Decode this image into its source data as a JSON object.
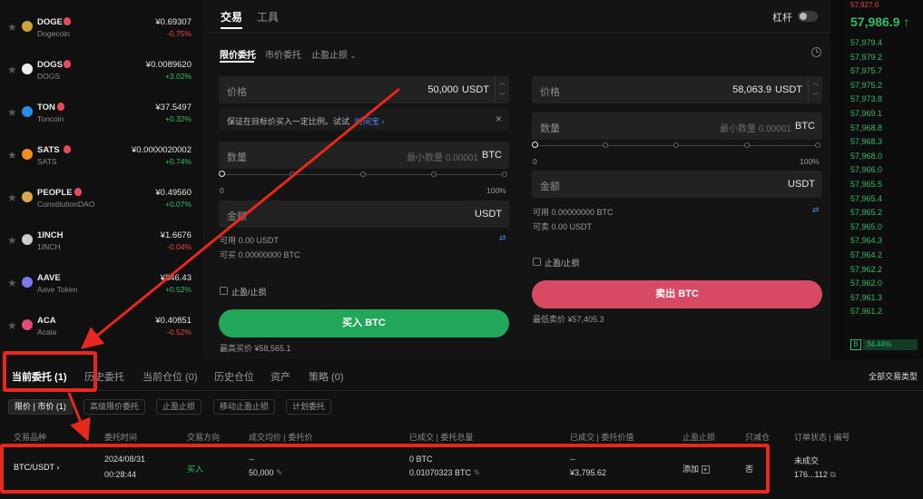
{
  "coins": [
    {
      "symbol": "DOGE",
      "name": "Dogecoin",
      "price": "¥0.69307",
      "change": "-0.75%",
      "dir": "down",
      "hot": true,
      "color": "#c9a43a"
    },
    {
      "symbol": "DOGS",
      "name": "DOGS",
      "price": "¥0.0089620",
      "change": "+3.02%",
      "dir": "up",
      "hot": true,
      "color": "#eeeeee"
    },
    {
      "symbol": "TON",
      "name": "Toncoin",
      "price": "¥37.5497",
      "change": "+0.32%",
      "dir": "up",
      "hot": true,
      "color": "#2a8de0"
    },
    {
      "symbol": "SATS",
      "name": "SATS",
      "price": "¥0.0000020002",
      "change": "+0.74%",
      "dir": "up",
      "hot": true,
      "color": "#f08a24"
    },
    {
      "symbol": "PEOPLE",
      "name": "ConstitutionDAO",
      "price": "¥0.49560",
      "change": "+0.07%",
      "dir": "up",
      "hot": true,
      "color": "#d9a84e"
    },
    {
      "symbol": "1INCH",
      "name": "1INCH",
      "price": "¥1.6676",
      "change": "-0.04%",
      "dir": "down",
      "hot": false,
      "color": "#cccccc"
    },
    {
      "symbol": "AAVE",
      "name": "Aave Token",
      "price": "¥846.43",
      "change": "+0.52%",
      "dir": "up",
      "hot": false,
      "color": "#7a7ae8"
    },
    {
      "symbol": "ACA",
      "name": "Acala",
      "price": "¥0.40851",
      "change": "-0.52%",
      "dir": "down",
      "hot": false,
      "color": "#e64a78"
    }
  ],
  "panel": {
    "tab_trade": "交易",
    "tab_tools": "工具",
    "leverage": "杠杆",
    "order_tabs": {
      "limit": "限价委托",
      "market": "市价委托",
      "stop": "止盈止损"
    },
    "buy": {
      "price_label": "价格",
      "price_value": "50,000",
      "price_unit": "USDT",
      "tip": "保证在目标价买入一定比例。试试",
      "tip_link": "时间宝",
      "qty_label": "数量",
      "qty_placeholder": "最小数量 0.00001",
      "qty_unit": "BTC",
      "slider_min": "0",
      "slider_max": "100%",
      "amount_label": "金额",
      "amount_unit": "USDT",
      "available": "可用 0.00 USDT",
      "can_buy": "可买 0.00000000 BTC",
      "tpsl": "止盈/止损",
      "button": "买入 BTC",
      "best": "最高买价 ¥58,565.1"
    },
    "sell": {
      "price_label": "价格",
      "price_value": "58,063.9",
      "price_unit": "USDT",
      "qty_label": "数量",
      "qty_placeholder": "最小数量 0.00001",
      "qty_unit": "BTC",
      "slider_min": "0",
      "slider_max": "100%",
      "amount_label": "金额",
      "amount_unit": "USDT",
      "available": "可用 0.00000000 BTC",
      "can_sell": "可卖 0.00 USDT",
      "tpsl": "止盈/止损",
      "button": "卖出 BTC",
      "best": "最低卖价 ¥57,405.3"
    }
  },
  "book": {
    "top": "57,927.0",
    "last": "57,986.9 ↑",
    "levels": [
      "57,979.4",
      "57,979.2",
      "57,975.7",
      "57,975.2",
      "57,973.8",
      "57,969.1",
      "57,968.8",
      "57,968.3",
      "57,968.0",
      "57,966.0",
      "57,965.5",
      "57,965.4",
      "57,965.2",
      "57,965.0",
      "57,964.3",
      "57,964.2",
      "57,962.2",
      "57,962.0",
      "57,961.3",
      "57,961.2"
    ],
    "buy_ratio": "34.44%",
    "buy_letter": "B"
  },
  "bottom": {
    "tabs": [
      "当前委托 (1)",
      "历史委托",
      "当前仓位 (0)",
      "历史仓位",
      "资产",
      "策略 (0)"
    ],
    "all_types": "全部交易类型",
    "chips": [
      "限价 | 市价 (1)",
      "高级限价委托",
      "止盈止损",
      "移动止盈止损",
      "计划委托"
    ],
    "headers": [
      "交易品种",
      "委托时间",
      "交易方向",
      "成交均价 | 委托价",
      "已成交 | 委托总量",
      "已成交 | 委托价值",
      "止盈止损",
      "只减仓",
      "订单状态 | 编号"
    ],
    "row": {
      "pair": "BTC/USDT",
      "date": "2024/08/31",
      "time": "00:28:44",
      "side": "买入",
      "avg": "--",
      "order_price": "50,000",
      "filled": "0 BTC",
      "total": "0.01070323 BTC",
      "filled_value": "--",
      "order_value": "¥3,795.62",
      "tpsl": "添加",
      "reduce": "否",
      "status": "未成交",
      "order_no": "176...112"
    }
  }
}
